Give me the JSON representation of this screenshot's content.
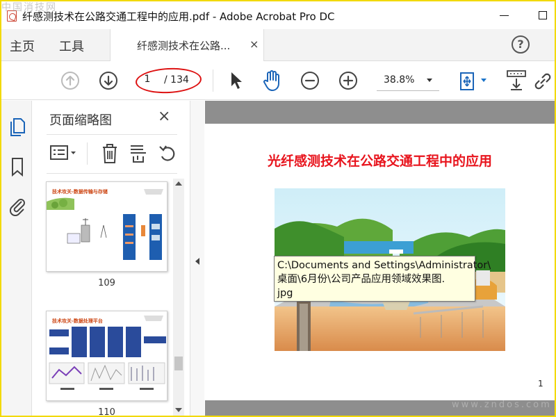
{
  "window": {
    "title": "纤感测技术在公路交通工程中的应用.pdf - Adobe Acrobat Pro DC",
    "watermark_top": "中国消技网"
  },
  "menu": {
    "home": "主页",
    "tools": "工具",
    "tab_label": "纤感测技术在公路...",
    "tab_close": "×",
    "help": "?"
  },
  "toolbar": {
    "current_page": "1",
    "total_pages": "/ 134",
    "zoom": "38.8%",
    "highlight_color": "#d11111"
  },
  "panel": {
    "title": "页面缩略图",
    "close": "×",
    "thumbnails": [
      {
        "page": "109",
        "title": "技术攻关-数据传输与存储"
      },
      {
        "page": "110",
        "title": "技术攻关-数据处理平台"
      }
    ]
  },
  "document": {
    "heading": "光纤感测技术在公路交通工程中的应用",
    "heading_color": "#e8141d",
    "page_number": "1",
    "tooltip": "C:\\Documents and Settings\\Administrator\\\n桌面\\6月份\\公司产品应用领域效果图.\njpg"
  },
  "watermark_bottom": "www.zndos.com"
}
